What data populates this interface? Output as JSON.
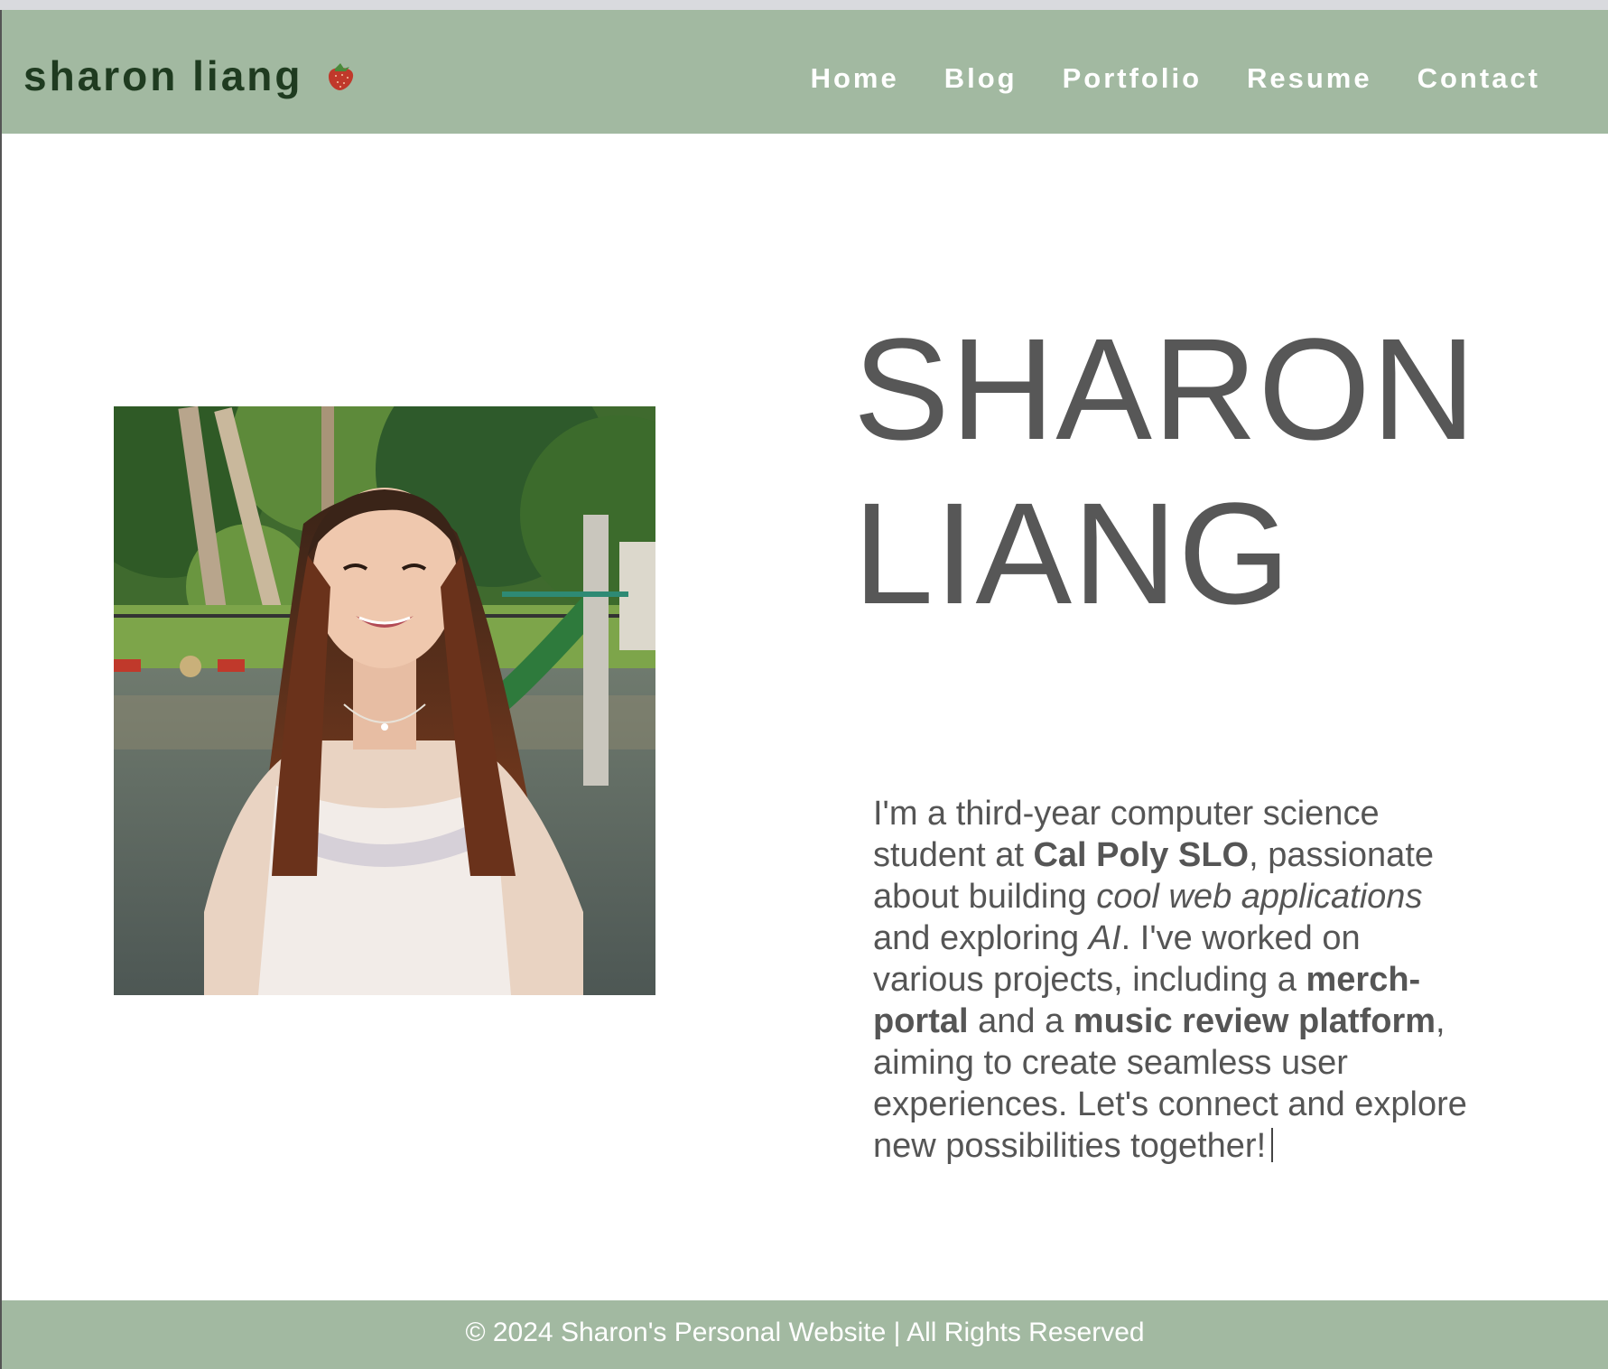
{
  "header": {
    "brand_name": "sharon liang",
    "brand_icon": "strawberry-icon",
    "nav": [
      {
        "label": "Home"
      },
      {
        "label": "Blog"
      },
      {
        "label": "Portfolio"
      },
      {
        "label": "Resume"
      },
      {
        "label": "Contact"
      }
    ]
  },
  "hero": {
    "name_line1": "SHARON",
    "name_line2": "LIANG",
    "photo_alt": "profile-photo",
    "bio": {
      "t1": "I'm a third-year computer science student at ",
      "b1": "Cal Poly SLO",
      "t2": ", passionate about building ",
      "i1": "cool web applications",
      "t3": " and exploring ",
      "i2": "AI",
      "t4": ". I've worked on various projects, including a ",
      "b2": "merch-portal",
      "t5": " and a ",
      "b3": "music review platform",
      "t6": ", aiming to create seamless user experiences. Let's connect and explore new possibilities together!"
    }
  },
  "footer": {
    "text": "© 2024 Sharon's Personal Website | All Rights Reserved"
  },
  "colors": {
    "nav_bg": "#a2b9a1",
    "brand_text": "#1f3b20",
    "hero_text": "#575757"
  }
}
